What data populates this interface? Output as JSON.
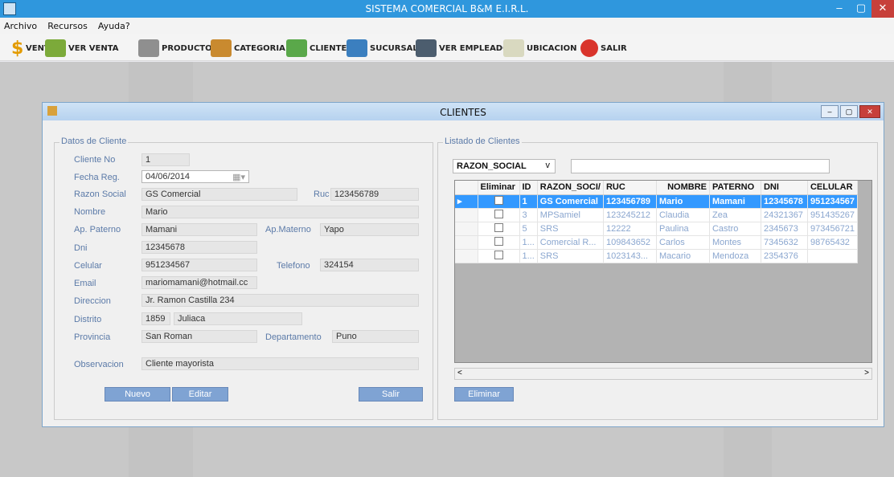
{
  "app": {
    "title": "SISTEMA COMERCIAL B&M E.I.R.L."
  },
  "window_controls": {
    "minimize": "–",
    "maximize": "▢",
    "close": "✕"
  },
  "menu": [
    "Archivo",
    "Recursos",
    "Ayuda?"
  ],
  "toolbar": [
    {
      "label": "VENTA",
      "icon": "dollar-icon",
      "color": "#e39b00"
    },
    {
      "label": "VER VENTA",
      "icon": "banknotes-icon",
      "color": "#7caa3a"
    },
    {
      "label": "PRODUCTOS",
      "icon": "products-icon",
      "color": "#8f8f8f"
    },
    {
      "label": "CATEGORIA",
      "icon": "category-icon",
      "color": "#c98a2f"
    },
    {
      "label": "CLIENTES",
      "icon": "clients-icon",
      "color": "#5aa84a"
    },
    {
      "label": "SUCURSAL",
      "icon": "branch-icon",
      "color": "#3b7fbf"
    },
    {
      "label": "VER EMPLEADOS",
      "icon": "employee-icon",
      "color": "#4c5d6e"
    },
    {
      "label": "UBICACION",
      "icon": "location-icon",
      "color": "#d9d9c0"
    },
    {
      "label": "SALIR",
      "icon": "exit-icon",
      "color": "#d9342b"
    }
  ],
  "child_window": {
    "title": "CLIENTES"
  },
  "client_form": {
    "group_title": "Datos de Cliente",
    "labels": {
      "cliente_no": "Cliente No",
      "fecha_reg": "Fecha Reg.",
      "razon_social": "Razon Social",
      "ruc": "Ruc",
      "nombre": "Nombre",
      "ap_paterno": "Ap. Paterno",
      "ap_materno": "Ap.Materno",
      "dni": "Dni",
      "celular": "Celular",
      "telefono": "Telefono",
      "email": "Email",
      "direccion": "Direccion",
      "distrito": "Distrito",
      "provincia": "Provincia",
      "departamento": "Departamento",
      "observacion": "Observacion"
    },
    "values": {
      "cliente_no": "1",
      "fecha_reg": "04/06/2014",
      "razon_social": "GS Comercial",
      "ruc": "123456789",
      "nombre": "Mario",
      "ap_paterno": "Mamani",
      "ap_materno": "Yapo",
      "dni": "12345678",
      "celular": "951234567",
      "telefono": "324154",
      "email": "mariomamani@hotmail.cc",
      "direccion": "Jr. Ramon Castilla 234",
      "distrito_code": "1859",
      "distrito_name": "Juliaca",
      "provincia": "San Roman",
      "departamento": "Puno",
      "observacion": "Cliente mayorista"
    },
    "buttons": {
      "nuevo": "Nuevo",
      "editar": "Editar",
      "salir": "Salir"
    }
  },
  "client_list": {
    "group_title": "Listado de Clientes",
    "filter_selected": "RAZON_SOCIAL",
    "filter_arrow": "v",
    "search_value": "",
    "columns": [
      "Eliminar",
      "ID",
      "RAZON_SOCI/",
      "RUC",
      "NOMBRE",
      "PATERNO",
      "DNI",
      "CELULAR"
    ],
    "rows": [
      {
        "id": "1",
        "razon": "GS Comercial",
        "ruc": "123456789",
        "nombre": "Mario",
        "paterno": "Mamani",
        "dni": "12345678",
        "celular": "951234567",
        "selected": true
      },
      {
        "id": "3",
        "razon": "MPSamiel",
        "ruc": "123245212",
        "nombre": "Claudia",
        "paterno": "Zea",
        "dni": "24321367",
        "celular": "951435267"
      },
      {
        "id": "5",
        "razon": "SRS",
        "ruc": "12222",
        "nombre": "Paulina",
        "paterno": "Castro",
        "dni": "2345673",
        "celular": "973456721"
      },
      {
        "id": "1...",
        "razon": "Comercial R...",
        "ruc": "109843652",
        "nombre": "Carlos",
        "paterno": "Montes",
        "dni": "7345632",
        "celular": "98765432"
      },
      {
        "id": "1...",
        "razon": "SRS",
        "ruc": "1023143...",
        "nombre": "Macario",
        "paterno": "Mendoza",
        "dni": "2354376",
        "celular": ""
      }
    ],
    "row_pointer": "▸",
    "scroll_left": "<",
    "scroll_right": ">",
    "delete_button": "Eliminar"
  }
}
